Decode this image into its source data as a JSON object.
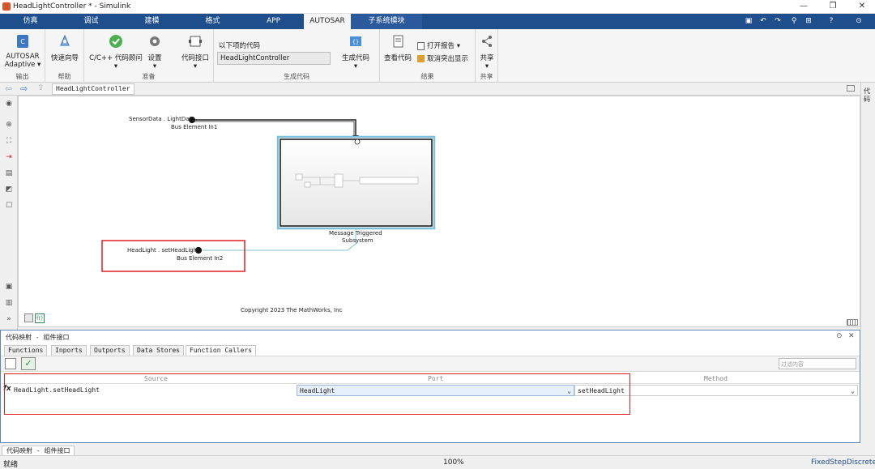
{
  "window": {
    "title": "HeadLightController * - Simulink",
    "minimize": "—",
    "restore": "❐",
    "close": "✕"
  },
  "tabs": [
    "仿真",
    "调试",
    "建模",
    "格式",
    "APP",
    "AUTOSAR",
    "子系统模块"
  ],
  "active_tab": "AUTOSAR",
  "ribbon": {
    "output": {
      "button": "AUTOSAR",
      "button2": "Adaptive ▾",
      "group": "输出"
    },
    "help": {
      "button": "快速向导",
      "group": "帮助"
    },
    "prepare": {
      "cpp_advisor": "C/C++ 代码顾问",
      "settings": "设置",
      "interface": "代码接口",
      "group": "准备",
      "caret": "▾"
    },
    "generate": {
      "label": "以下项的代码",
      "model_value": "HeadLightController",
      "gen_button": "生成代码",
      "group": "生成代码",
      "caret": "▾"
    },
    "results": {
      "view_code": "查看代码",
      "open_report": "打开报告",
      "open_report_caret": "▾",
      "remove_highlight": "取消突出显示",
      "group": "结果"
    },
    "share": {
      "button": "共享",
      "caret": "▾",
      "group": "共享"
    }
  },
  "explorer": {
    "breadcrumb": "HeadLightController"
  },
  "canvas": {
    "in1_signal": "SensorData . LightData",
    "in1_name": "Bus Element In1",
    "subsystem_name_1": "Message Triggered",
    "subsystem_name_2": "Subsystem",
    "in2_signal": "HeadLight . setHeadLight",
    "in2_name": "Bus Element In2",
    "copyright": "Copyright 2023 The MathWorks, Inc"
  },
  "right_strip": {
    "label": "代码"
  },
  "mapping_panel": {
    "title": "代码映射 - 组件接口",
    "tabs": [
      "Functions",
      "Inports",
      "Outports",
      "Data Stores",
      "Function Callers"
    ],
    "active_tab": "Function Callers",
    "filter_placeholder": "过滤内容",
    "columns": [
      "Source",
      "Port",
      "Method"
    ],
    "rows": [
      {
        "icon": "fx",
        "source": "HeadLight.setHeadLight",
        "port": "HeadLight",
        "method": "setHeadLight"
      }
    ]
  },
  "bottom_tab": "代码映射 - 组件接口",
  "status": {
    "left": "就绪",
    "zoom": "100%",
    "solver": "FixedStepDiscrete"
  },
  "colors": {
    "tab_bar": "#1f4e8c",
    "highlight_red": "#e02020",
    "panel_border": "#5b87b8"
  }
}
